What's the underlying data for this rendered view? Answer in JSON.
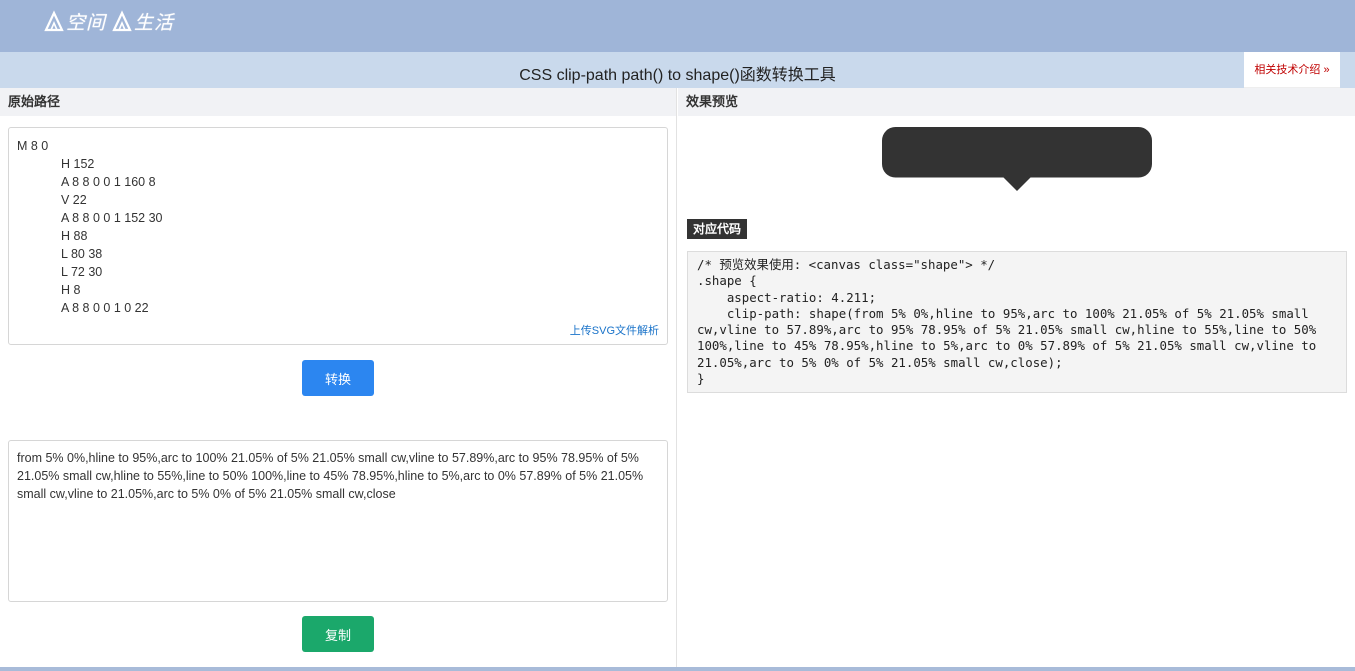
{
  "brand": {
    "logo_text_1": "空间",
    "logo_text_2": "生活"
  },
  "header": {
    "title": "CSS clip-path path() to shape()函数转换工具",
    "intro_link": "相关技术介绍 »"
  },
  "left": {
    "source_heading": "原始路径",
    "path_lines": [
      "M 8 0",
      "H 152",
      "A 8 8 0 0 1 160 8",
      "V 22",
      "A 8 8 0 0 1 152 30",
      "H 88",
      "L 80 38",
      "L 72 30",
      "H 8",
      "A 8 8 0 0 1 0 22"
    ],
    "upload_link": "上传SVG文件解析",
    "convert_button": "转换",
    "output_text": "from 5% 0%,hline to 95%,arc to 100% 21.05% of 5% 21.05% small cw,vline to 57.89%,arc to 95% 78.95% of 5% 21.05% small cw,hline to 55%,line to 50% 100%,line to 45% 78.95%,hline to 5%,arc to 0% 57.89% of 5% 21.05% small cw,vline to 21.05%,arc to 5% 0% of 5% 21.05% small cw,close",
    "copy_button": "复制"
  },
  "right": {
    "preview_heading": "效果预览",
    "preview_fill": "#333333",
    "code_label": "对应代码",
    "code_text": "/* 预览效果使用: <canvas class=\"shape\"> */\n.shape {\n    aspect-ratio: 4.211;\n    clip-path: shape(from 5% 0%,hline to 95%,arc to 100% 21.05% of 5% 21.05% small cw,vline to 57.89%,arc to 95% 78.95% of 5% 21.05% small cw,hline to 55%,line to 50% 100%,line to 45% 78.95%,hline to 5%,arc to 0% 57.89% of 5% 21.05% small cw,vline to 21.05%,arc to 5% 0% of 5% 21.05% small cw,close);\n}"
  },
  "colors": {
    "topbar": "#9fb5d8",
    "titlebar": "#c9d9ec",
    "convert": "#2c86f0",
    "copy": "#1ba86b",
    "link_red": "#c00000",
    "link_blue": "#1a73c9"
  }
}
